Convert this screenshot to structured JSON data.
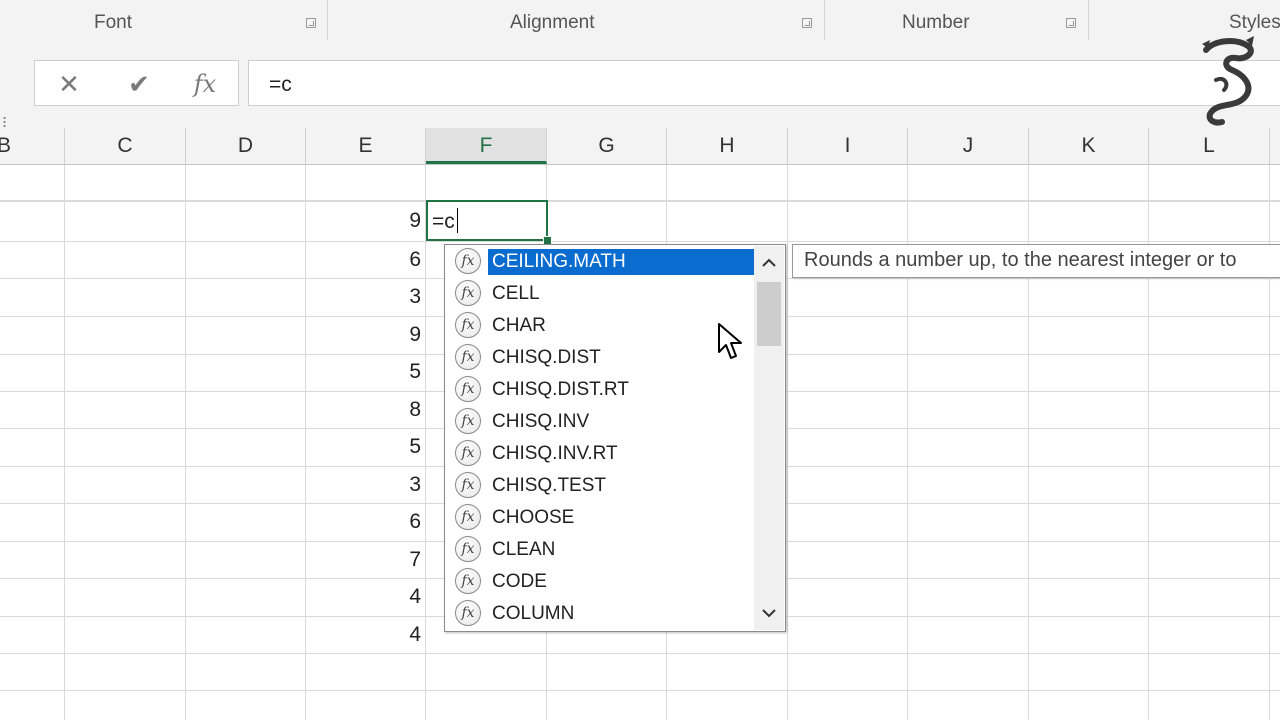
{
  "ribbon": {
    "groups": [
      {
        "label": "Font"
      },
      {
        "label": "Alignment"
      },
      {
        "label": "Number"
      },
      {
        "label": "Styles"
      }
    ]
  },
  "formula_bar": {
    "cancel_icon": "✕",
    "enter_icon": "✔",
    "function_icon": "fx",
    "content": "=c"
  },
  "columns": [
    "B",
    "C",
    "D",
    "E",
    "F",
    "G",
    "H",
    "I",
    "J",
    "K",
    "L"
  ],
  "active_column": "F",
  "column_e_values": [
    "9",
    "6",
    "3",
    "9",
    "5",
    "8",
    "5",
    "3",
    "6",
    "7",
    "4",
    "4"
  ],
  "active_cell": {
    "column": "F",
    "value": "=c"
  },
  "autocomplete": {
    "icon": "fx",
    "items": [
      "CEILING.MATH",
      "CELL",
      "CHAR",
      "CHISQ.DIST",
      "CHISQ.DIST.RT",
      "CHISQ.INV",
      "CHISQ.INV.RT",
      "CHISQ.TEST",
      "CHOOSE",
      "CLEAN",
      "CODE",
      "COLUMN"
    ],
    "selected_index": 0,
    "scroll_up_icon": "chevron-up-icon",
    "scroll_down_icon": "chevron-down-icon"
  },
  "tooltip": "Rounds a number up, to the nearest integer or to",
  "colors": {
    "accent_green": "#217346",
    "selection_blue": "#0a6ccf",
    "ribbon_bg": "#f3f3f3",
    "grid_line": "#dadada"
  }
}
